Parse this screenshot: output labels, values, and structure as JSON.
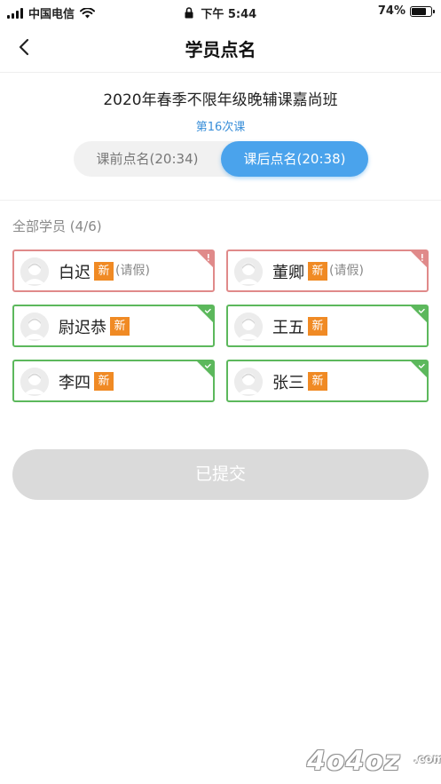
{
  "status_bar": {
    "carrier": "中国电信",
    "time": "下午 5:44",
    "battery": "74%",
    "battery_level": 0.74
  },
  "nav": {
    "title": "学员点名",
    "back_icon": "chevron-left-icon"
  },
  "class_info": {
    "title": "2020年春季不限年级晚辅课嘉尚班",
    "lesson": "第16次课"
  },
  "segment": {
    "before": "课前点名(20:34)",
    "after": "课后点名(20:38)",
    "selected": "after",
    "accent": "#4aa3ec"
  },
  "students_label": "全部学员 (4/6)",
  "students": [
    {
      "name": "白迟",
      "tag": "新",
      "note": "(请假)",
      "status": "leave"
    },
    {
      "name": "董卿",
      "tag": "新",
      "note": "(请假)",
      "status": "leave"
    },
    {
      "name": "尉迟恭",
      "tag": "新",
      "note": "",
      "status": "present"
    },
    {
      "name": "王五",
      "tag": "新",
      "note": "",
      "status": "present"
    },
    {
      "name": "李四",
      "tag": "新",
      "note": "",
      "status": "present"
    },
    {
      "name": "张三",
      "tag": "新",
      "note": "",
      "status": "present"
    }
  ],
  "colors": {
    "present": "#5cb85c",
    "leave": "#e08a8a",
    "tag": "#f08a24"
  },
  "submit_label": "已提交",
  "watermark": {
    "text": "4o4oz",
    "suffix": ".com"
  }
}
